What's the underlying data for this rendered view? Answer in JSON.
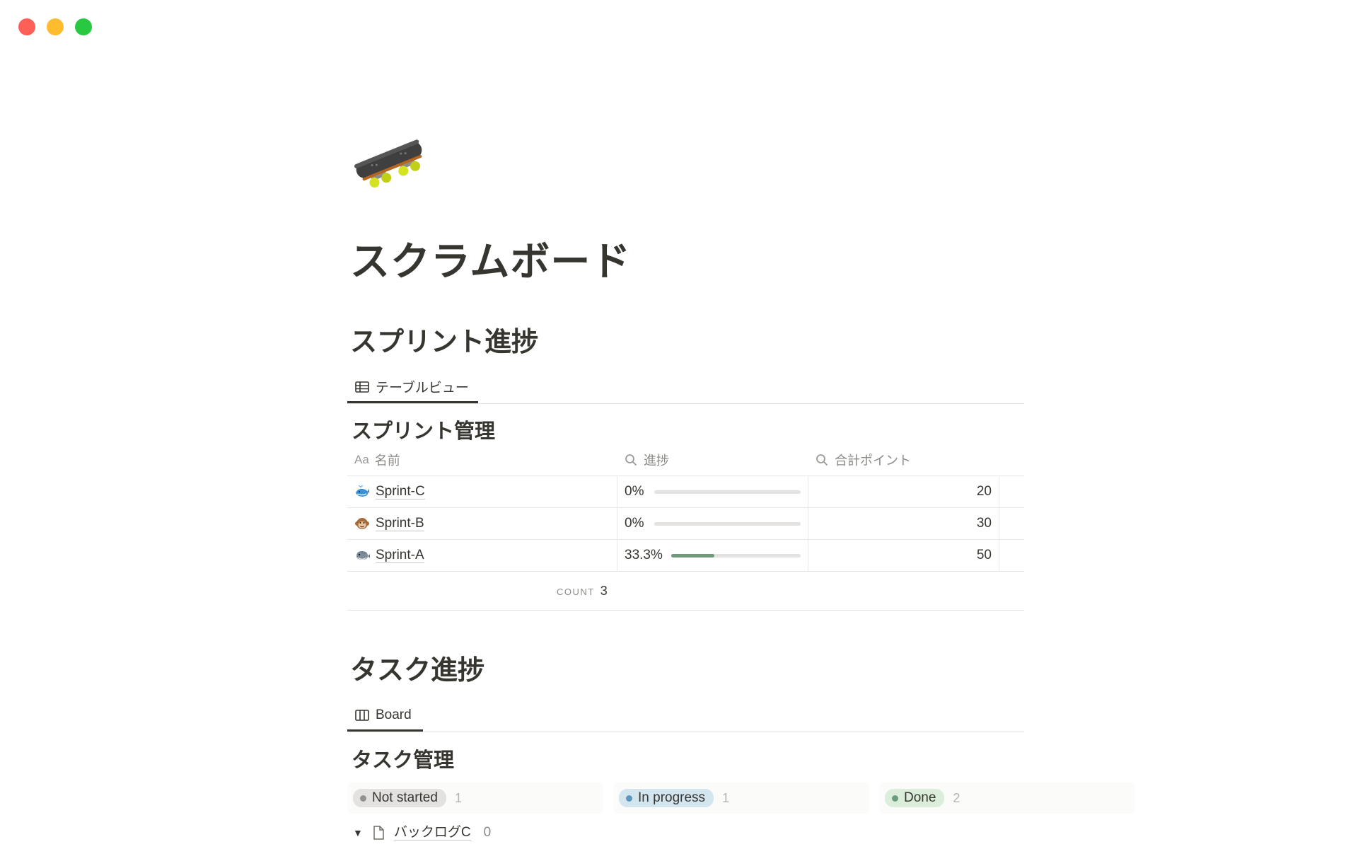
{
  "window": {
    "controls": [
      "close",
      "minimize",
      "maximize"
    ]
  },
  "page": {
    "icon": "skateboard-icon",
    "title": "スクラムボード"
  },
  "sprint_section": {
    "heading": "スプリント進捗",
    "view_tab": {
      "icon": "table-icon",
      "label": "テーブルビュー"
    },
    "db_title": "スプリント管理",
    "columns": [
      {
        "icon": "Aa",
        "label": "名前"
      },
      {
        "icon": "search-icon",
        "label": "進捗"
      },
      {
        "icon": "search-icon",
        "label": "合計ポイント"
      }
    ],
    "rows": [
      {
        "icon": "whale-icon",
        "name": "Sprint-C",
        "progress_label": "0%",
        "progress": 0,
        "points": "20"
      },
      {
        "icon": "monkey-icon",
        "name": "Sprint-B",
        "progress_label": "0%",
        "progress": 0,
        "points": "30"
      },
      {
        "icon": "pufferfish-icon",
        "name": "Sprint-A",
        "progress_label": "33.3%",
        "progress": 0.333,
        "points": "50"
      }
    ],
    "footer": {
      "count_label": "COUNT",
      "count_value": "3"
    }
  },
  "task_section": {
    "heading": "タスク進捗",
    "view_tab": {
      "icon": "board-icon",
      "label": "Board"
    },
    "db_title": "タスク管理",
    "columns": [
      {
        "label": "Not started",
        "count": "1",
        "bg": "#e3e2e0",
        "dot": "#91918e"
      },
      {
        "label": "In progress",
        "count": "1",
        "bg": "#d3e5ef",
        "dot": "#5b97bd"
      },
      {
        "label": "Done",
        "count": "2",
        "bg": "#dbeddb",
        "dot": "#6c9b7d"
      }
    ],
    "group": {
      "label": "バックログC",
      "count": "0",
      "icon": "page-icon"
    }
  },
  "colors": {
    "text": "#37352f",
    "muted": "#8b8a86",
    "progress_fill": "#6d9a78"
  }
}
